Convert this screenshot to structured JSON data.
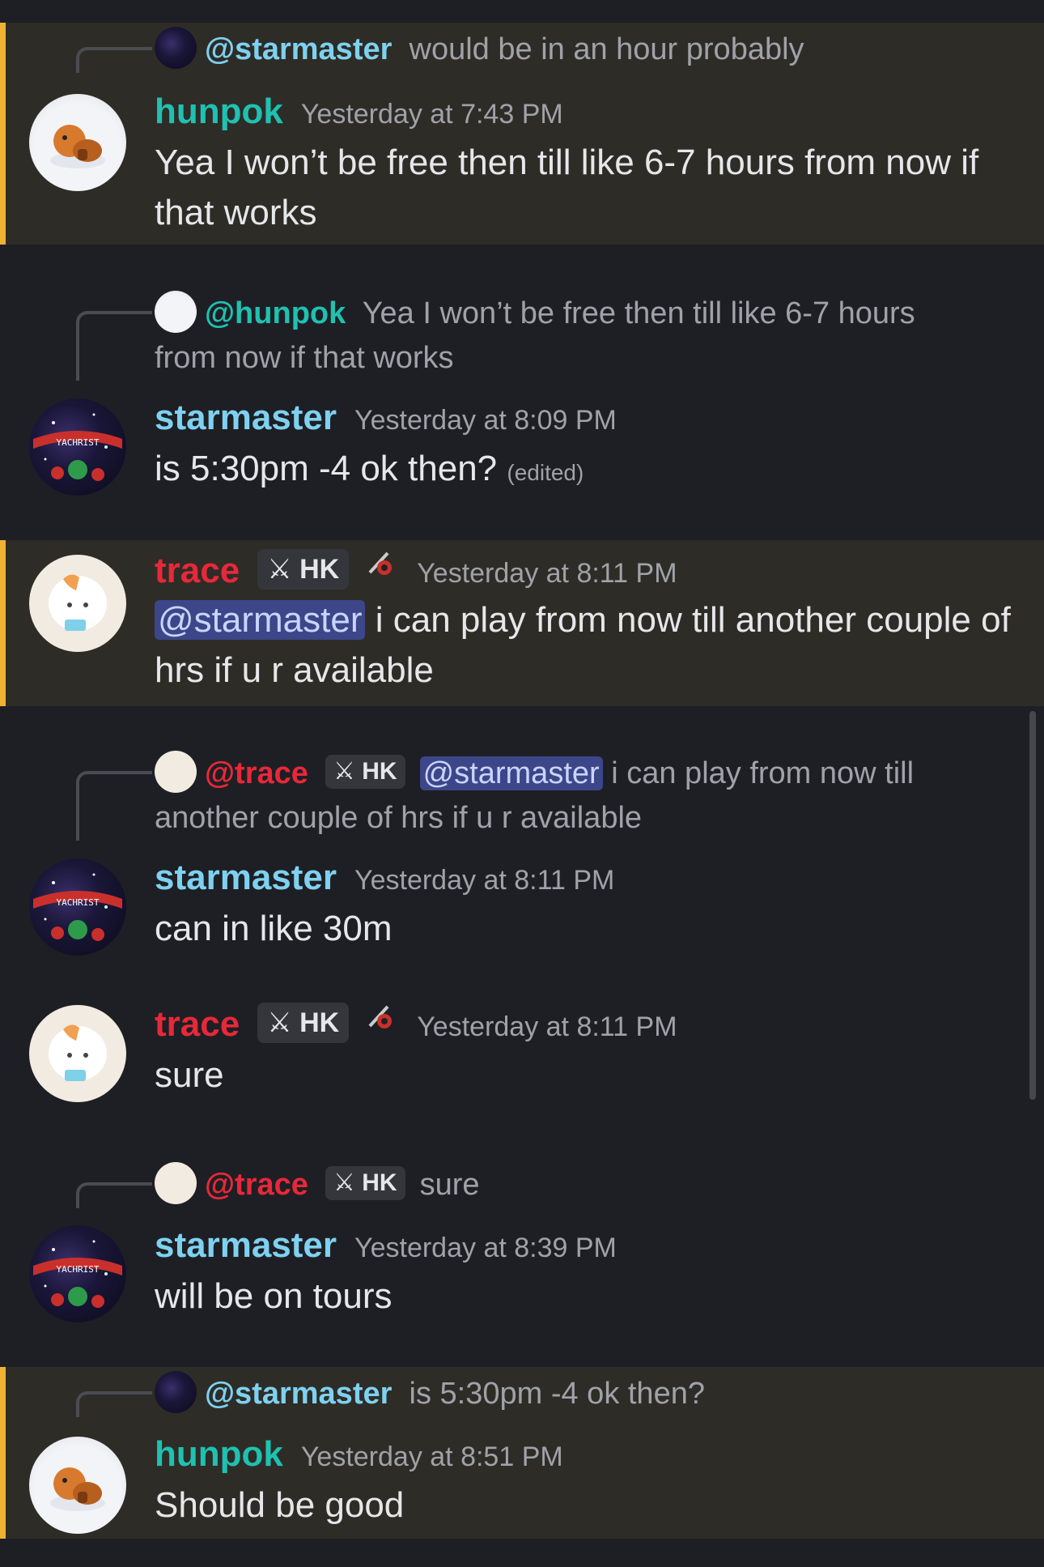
{
  "messages": [
    {
      "reply": {
        "user": "@starmaster",
        "user_tags": [],
        "text": "would be in an hour probably"
      },
      "author": "hunpok",
      "tags": [],
      "timestamp": "Yesterday at 7:43 PM",
      "mention": "",
      "body": "Yea I won’t be free then till like 6-7 hours from now if that works",
      "edited": "",
      "highlighted": true
    },
    {
      "reply": {
        "user": "@hunpok",
        "user_tags": [],
        "text": "Yea I won’t be free then till like 6-7 hours from now if that works"
      },
      "author": "starmaster",
      "tags": [],
      "timestamp": "Yesterday at 8:09 PM",
      "mention": "",
      "body": "is 5:30pm -4 ok then?",
      "edited": "(edited)",
      "highlighted": false
    },
    {
      "reply": null,
      "author": "trace",
      "tags": [
        "HK"
      ],
      "timestamp": "Yesterday at 8:11 PM",
      "mention": "@starmaster",
      "body": "i can play from now till another couple of hrs if u r available",
      "edited": "",
      "highlighted": true
    },
    {
      "reply": {
        "user": "@trace",
        "user_tags": [
          "HK"
        ],
        "mention": "@starmaster",
        "text": "i can play from now till another couple of hrs if u r available"
      },
      "author": "starmaster",
      "tags": [],
      "timestamp": "Yesterday at 8:11 PM",
      "mention": "",
      "body": "can in like 30m",
      "edited": "",
      "highlighted": false
    },
    {
      "reply": null,
      "author": "trace",
      "tags": [
        "HK"
      ],
      "timestamp": "Yesterday at 8:11 PM",
      "mention": "",
      "body": "sure",
      "edited": "",
      "highlighted": false
    },
    {
      "reply": {
        "user": "@trace",
        "user_tags": [
          "HK"
        ],
        "text": "sure"
      },
      "author": "starmaster",
      "tags": [],
      "timestamp": "Yesterday at 8:39 PM",
      "mention": "",
      "body": "will be on tours",
      "edited": "",
      "highlighted": false
    },
    {
      "reply": {
        "user": "@starmaster",
        "user_tags": [],
        "text": "is 5:30pm -4 ok then?"
      },
      "author": "hunpok",
      "tags": [],
      "timestamp": "Yesterday at 8:51 PM",
      "mention": "",
      "body": "Should be good",
      "edited": "",
      "highlighted": true
    }
  ],
  "avatar_text": {
    "starmaster": "YACHRIST"
  },
  "colors": {
    "background": "#1e1f24",
    "highlight_background": "#2e2c26",
    "highlight_bar": "#f0b232",
    "hunpok": "#1fc1b1",
    "starmaster": "#7ed1f0",
    "trace": "#e8283a",
    "mention_bg": "#3c4688"
  }
}
